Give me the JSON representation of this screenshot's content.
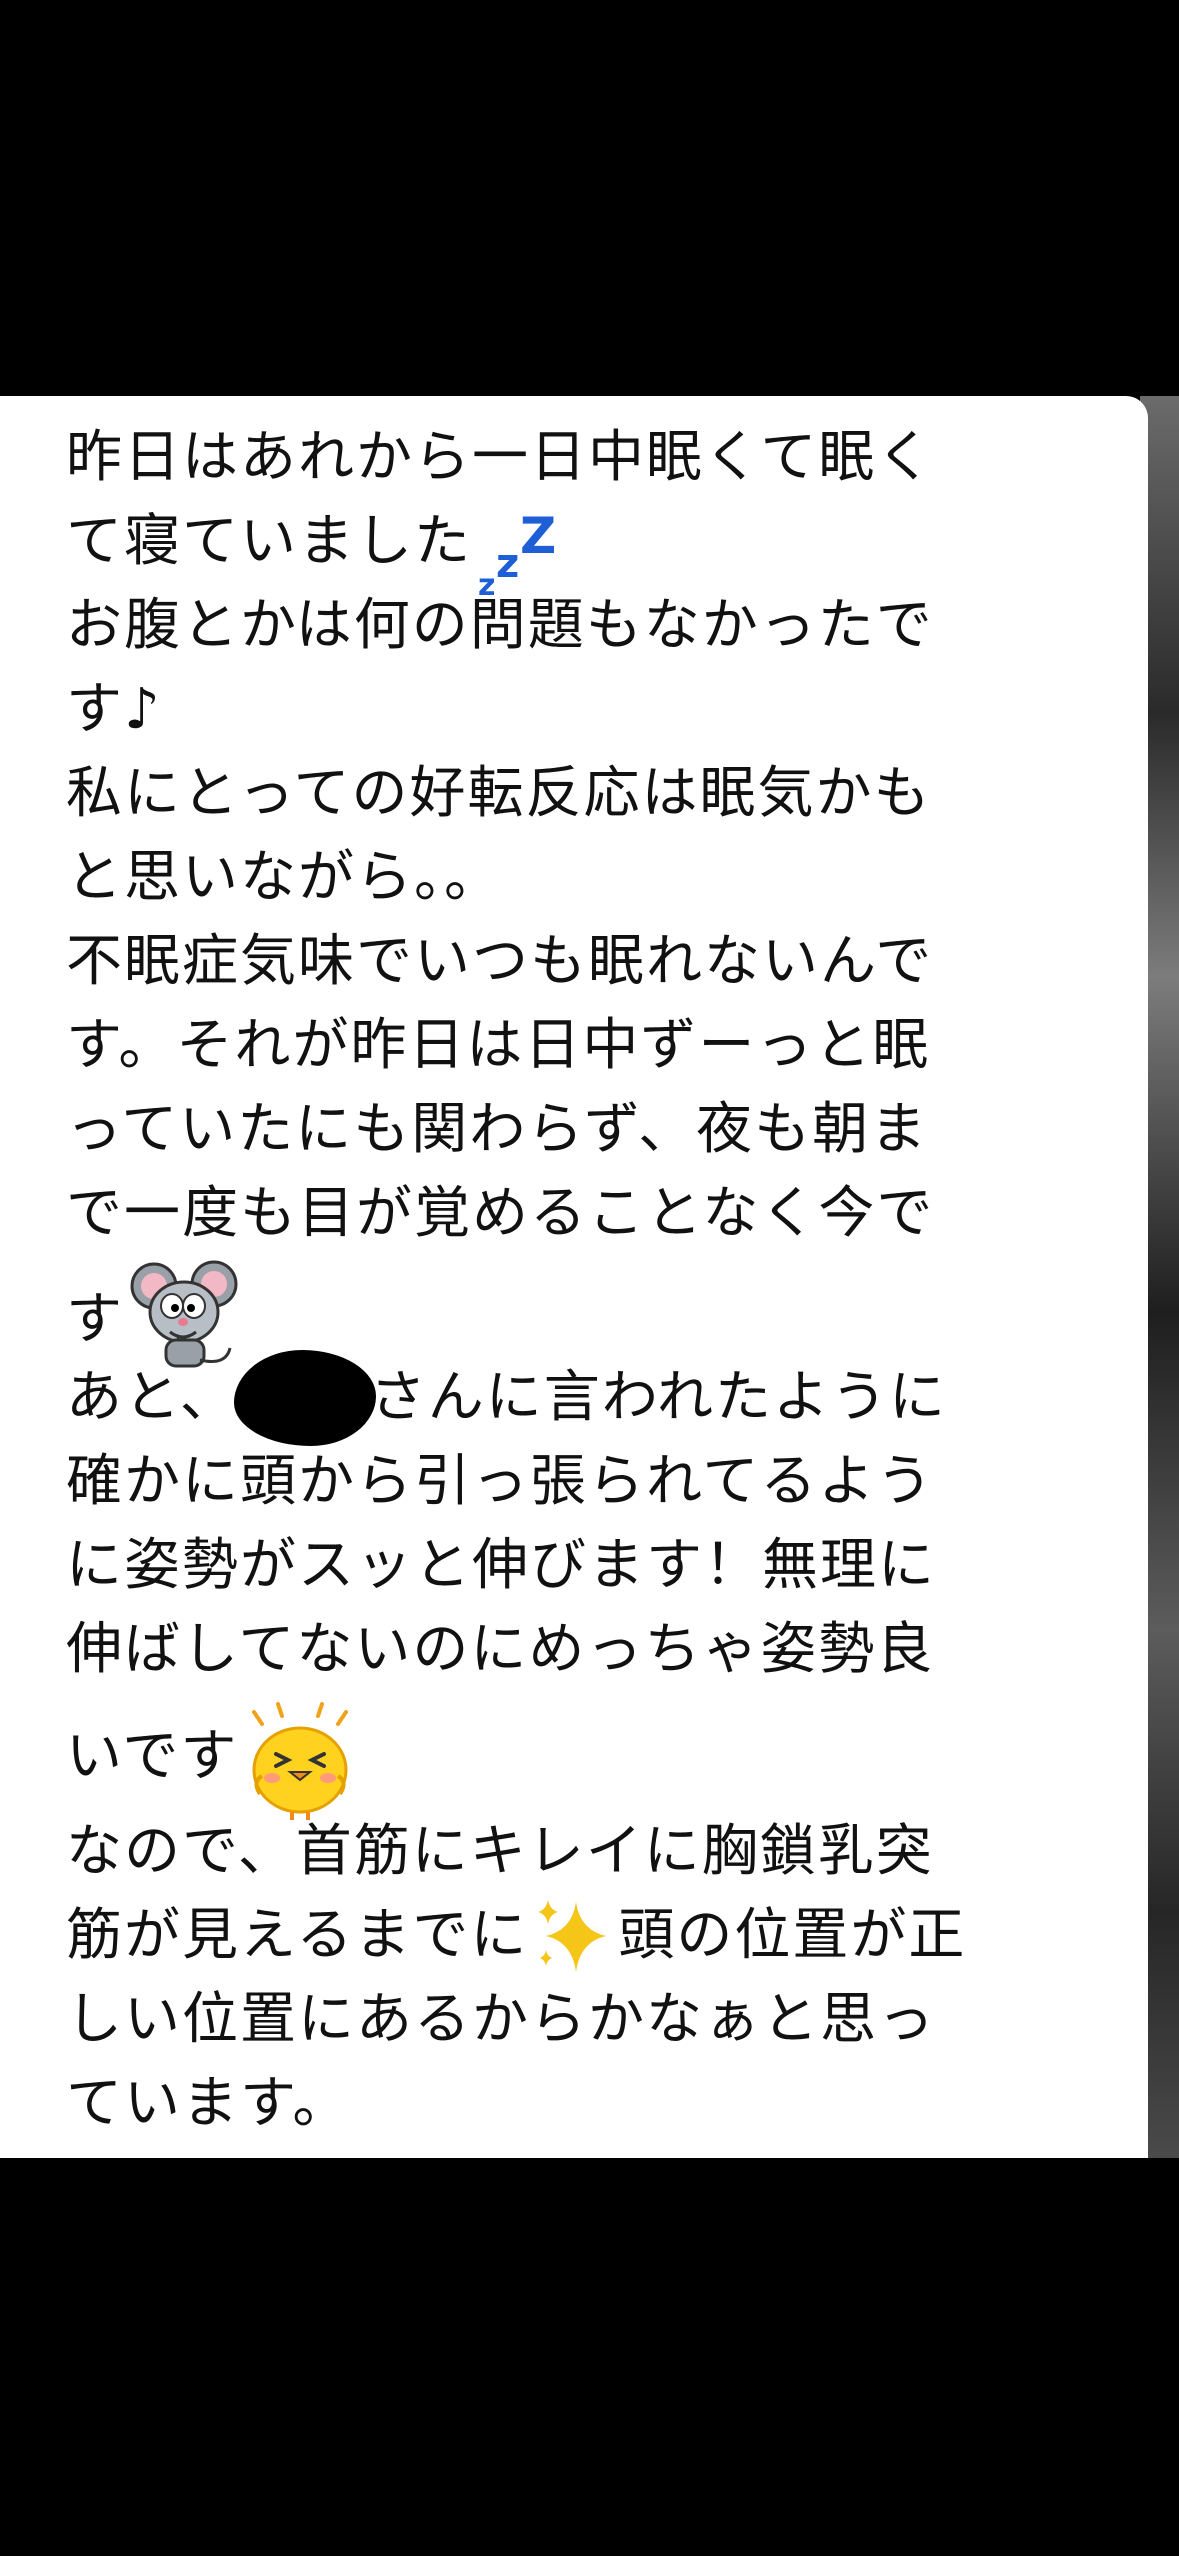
{
  "message": {
    "lines": [
      "昨日はあれから一日中眠くて眠く",
      "て寝ていました",
      "お腹とかは何の問題もなかったで",
      "す♪",
      "私にとっての好転反応は眠気かも",
      "と思いながら。。",
      "不眠症気味でいつも眠れないんで",
      "す。それが昨日は日中ずーっと眠",
      "っていたにも関わらず、夜も朝ま",
      "で一度も目が覚めることなく今で",
      "す",
      "あと、",
      "さんに言われたように",
      "確かに頭から引っ張られてるよう",
      "に姿勢がスッと伸びます！無理に",
      "伸ばしてないのにめっちゃ姿勢良",
      "いです",
      "なので、首筋にキレイに胸鎖乳突",
      "筋が見えるまでに",
      "頭の位置が正",
      "しい位置にあるからかなぁと思っ",
      "ています。"
    ],
    "icons": {
      "zzz": "sleeping-zzz-icon",
      "mouse": "mouse-sticker-icon",
      "chick": "happy-chick-icon",
      "sparkle": "sparkles-icon"
    },
    "colors": {
      "bubble": "#ffffff",
      "text": "#111111",
      "zzz": "#1f5fd6",
      "sparkle": "#f5c518"
    }
  }
}
